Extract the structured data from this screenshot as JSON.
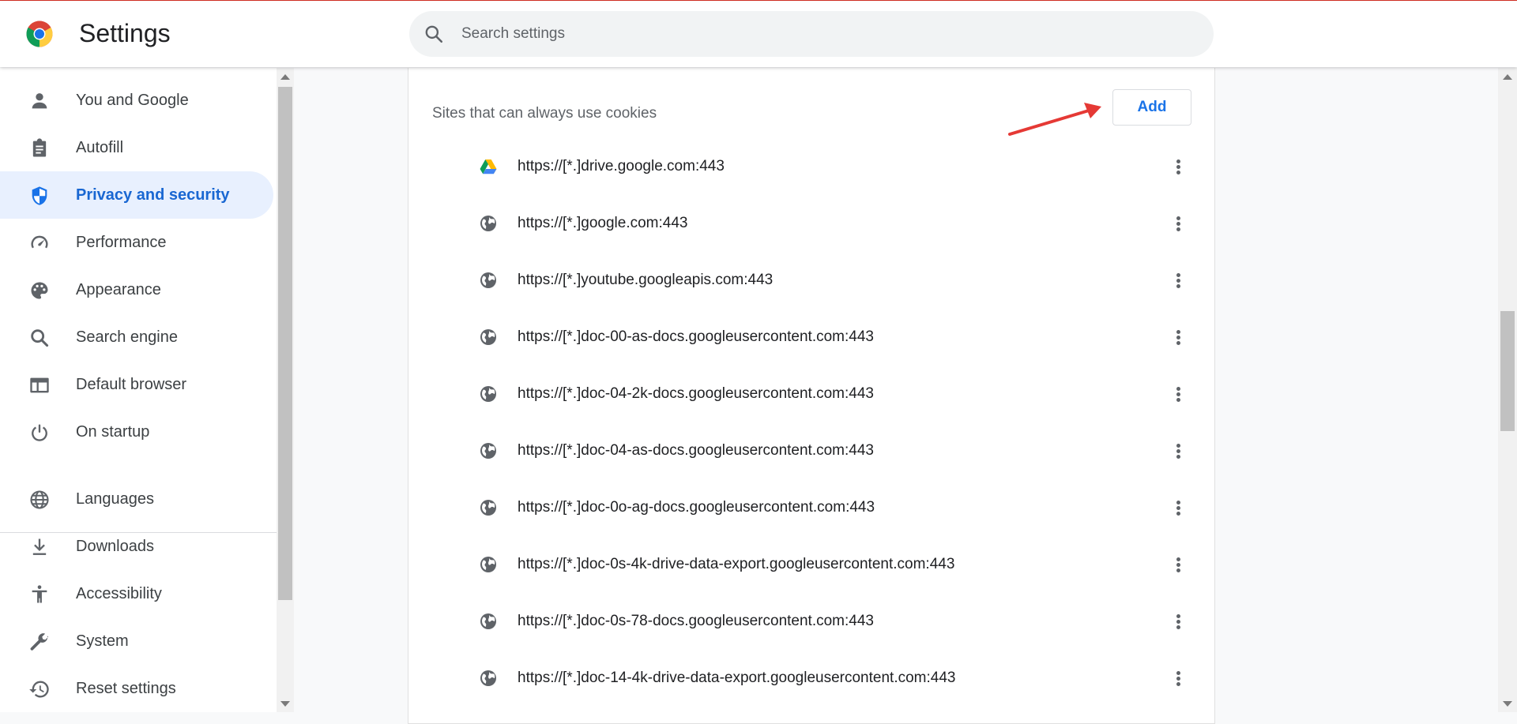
{
  "header": {
    "title": "Settings",
    "search_placeholder": "Search settings"
  },
  "sidebar": {
    "items": [
      {
        "label": "You and Google",
        "icon": "person-icon",
        "active": false
      },
      {
        "label": "Autofill",
        "icon": "clipboard-icon",
        "active": false
      },
      {
        "label": "Privacy and security",
        "icon": "shield-icon",
        "active": true
      },
      {
        "label": "Performance",
        "icon": "speedometer-icon",
        "active": false
      },
      {
        "label": "Appearance",
        "icon": "palette-icon",
        "active": false
      },
      {
        "label": "Search engine",
        "icon": "search-icon",
        "active": false
      },
      {
        "label": "Default browser",
        "icon": "browser-window-icon",
        "active": false
      },
      {
        "label": "On startup",
        "icon": "power-icon",
        "active": false
      },
      {
        "label": "Languages",
        "icon": "globe-icon",
        "active": false
      },
      {
        "label": "Downloads",
        "icon": "download-icon",
        "active": false
      },
      {
        "label": "Accessibility",
        "icon": "accessibility-icon",
        "active": false
      },
      {
        "label": "System",
        "icon": "wrench-icon",
        "active": false
      },
      {
        "label": "Reset settings",
        "icon": "restore-icon",
        "active": false
      }
    ]
  },
  "main": {
    "section_label": "Sites that can always use cookies",
    "add_label": "Add",
    "sites": [
      {
        "url": "https://[*.]drive.google.com:443",
        "icon": "google-drive-icon"
      },
      {
        "url": "https://[*.]google.com:443",
        "icon": "globe-icon"
      },
      {
        "url": "https://[*.]youtube.googleapis.com:443",
        "icon": "globe-icon"
      },
      {
        "url": "https://[*.]doc-00-as-docs.googleusercontent.com:443",
        "icon": "globe-icon"
      },
      {
        "url": "https://[*.]doc-04-2k-docs.googleusercontent.com:443",
        "icon": "globe-icon"
      },
      {
        "url": "https://[*.]doc-04-as-docs.googleusercontent.com:443",
        "icon": "globe-icon"
      },
      {
        "url": "https://[*.]doc-0o-ag-docs.googleusercontent.com:443",
        "icon": "globe-icon"
      },
      {
        "url": "https://[*.]doc-0s-4k-drive-data-export.googleusercontent.com:443",
        "icon": "globe-icon"
      },
      {
        "url": "https://[*.]doc-0s-78-docs.googleusercontent.com:443",
        "icon": "globe-icon"
      },
      {
        "url": "https://[*.]doc-14-4k-drive-data-export.googleusercontent.com:443",
        "icon": "globe-icon"
      }
    ]
  },
  "colors": {
    "accent": "#1a73e8",
    "active_nav_bg": "#e8f0fe",
    "annotation_arrow": "#e53935"
  }
}
